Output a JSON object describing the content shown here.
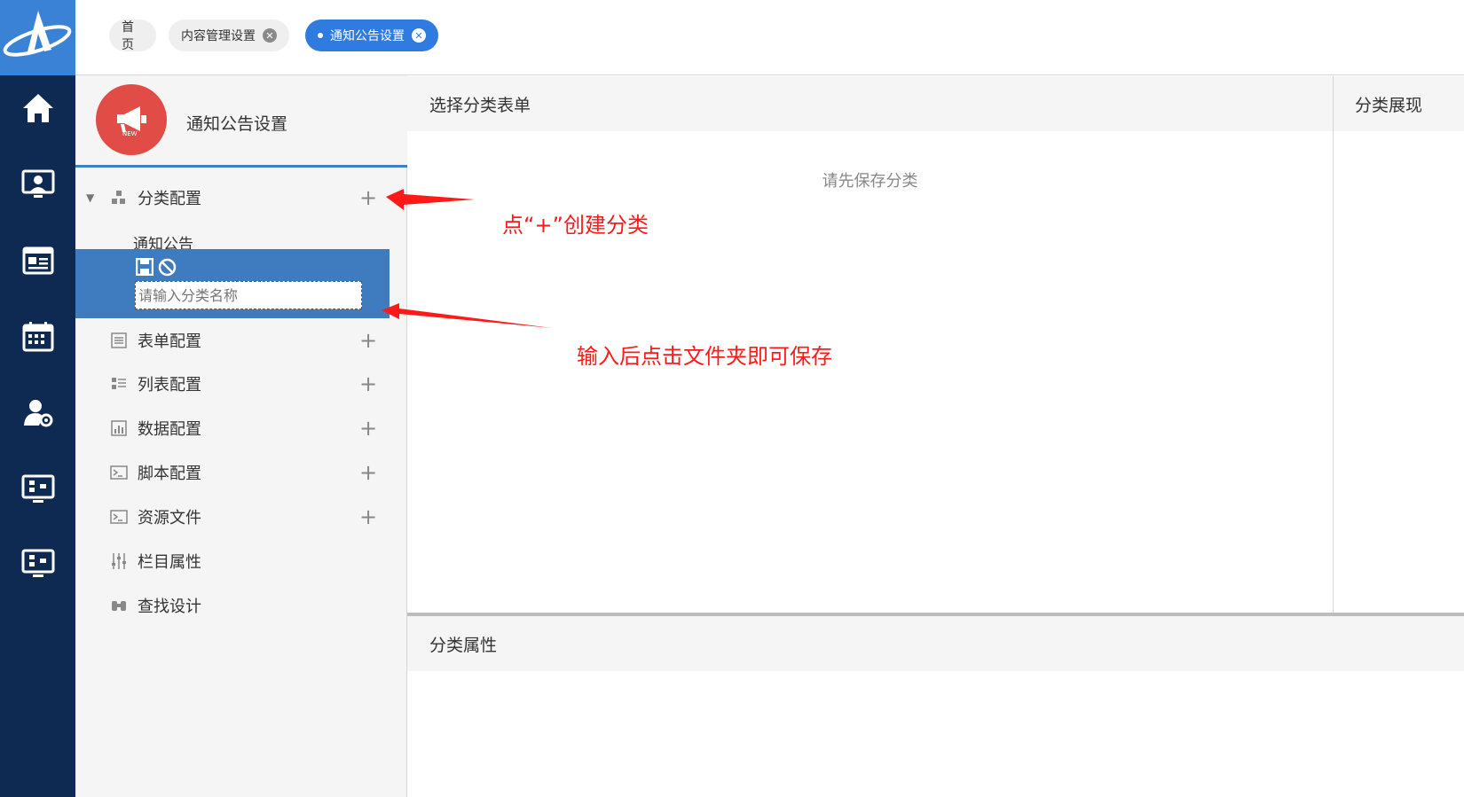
{
  "tabs": [
    {
      "label": "首页",
      "closable": false
    },
    {
      "label": "内容管理设置",
      "closable": true
    },
    {
      "label": "通知公告设置",
      "closable": true,
      "active": true
    }
  ],
  "rail_icons": [
    "home-icon",
    "monitor-user-icon",
    "news-icon",
    "calendar-icon",
    "user-settings-icon",
    "flow-monitor-icon",
    "flow-monitor-icon"
  ],
  "sidebar": {
    "title": "通知公告设置",
    "avatar_badge": "NEW",
    "items": [
      {
        "label": "分类配置",
        "icon": "classify-icon",
        "plus": true,
        "expanded": true
      },
      {
        "label": "通知公告"
      },
      {
        "label": "表单配置",
        "icon": "form-icon",
        "plus": true
      },
      {
        "label": "列表配置",
        "icon": "list-icon",
        "plus": true
      },
      {
        "label": "数据配置",
        "icon": "chart-icon",
        "plus": true
      },
      {
        "label": "脚本配置",
        "icon": "script-icon",
        "plus": true
      },
      {
        "label": "资源文件",
        "icon": "script-icon",
        "plus": true
      },
      {
        "label": "栏目属性",
        "icon": "sliders-icon",
        "plus": false
      },
      {
        "label": "查找设计",
        "icon": "binoculars-icon",
        "plus": false
      }
    ],
    "new_category_input": {
      "placeholder": "请输入分类名称",
      "value": ""
    }
  },
  "main": {
    "title": "选择分类表单",
    "empty_text": "请先保存分类"
  },
  "right": {
    "title": "分类展现"
  },
  "attributes": {
    "title": "分类属性"
  },
  "annotations": {
    "plus_hint": "点“+”创建分类",
    "save_hint": "输入后点击文件夹即可保存"
  },
  "colors": {
    "rail": "#0e2a52",
    "logo_bg": "#3a82d6",
    "accent": "#2f7be0",
    "selected_row": "#3f7bbf",
    "annotation": "#ff1a1a",
    "avatar": "#e24c46"
  }
}
